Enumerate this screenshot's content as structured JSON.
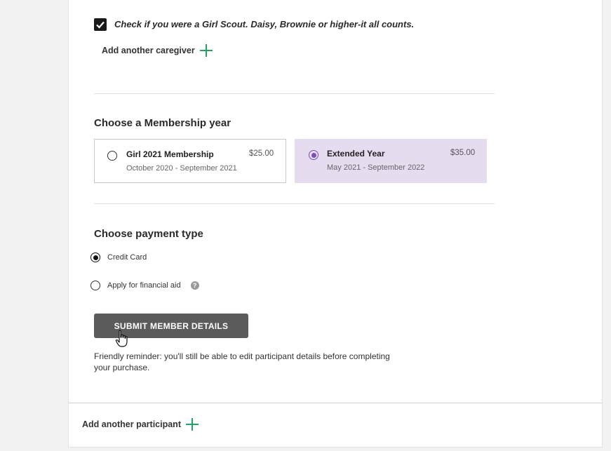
{
  "caregiver": {
    "girl_scout_check_label": "Check if you were a Girl Scout. Daisy, Brownie or higher-it all counts.",
    "girl_scout_checked": true,
    "add_caregiver_label": "Add another caregiver"
  },
  "membership": {
    "title": "Choose a Membership year",
    "options": [
      {
        "name": "Girl 2021 Membership",
        "price": "$25.00",
        "range": "October 2020 - September 2021",
        "selected": false
      },
      {
        "name": "Extended Year",
        "price": "$35.00",
        "range": "May 2021 - September 2022",
        "selected": true
      }
    ]
  },
  "payment": {
    "title": "Choose payment type",
    "options": [
      {
        "label": "Credit Card",
        "selected": true
      },
      {
        "label": "Apply for financial aid",
        "selected": false,
        "help_icon": "question-circle-icon"
      }
    ],
    "submit_label": "SUBMIT MEMBER DETAILS",
    "reminder": "Friendly reminder: you'll still be able to edit participant details before completing your purchase."
  },
  "footer": {
    "add_participant_label": "Add another participant"
  },
  "colors": {
    "accent_green": "#1fa463",
    "selected_option_bg": "#e6dcef",
    "radio_purple": "#7b4fb5",
    "submit_bg": "#5b5b5b"
  }
}
